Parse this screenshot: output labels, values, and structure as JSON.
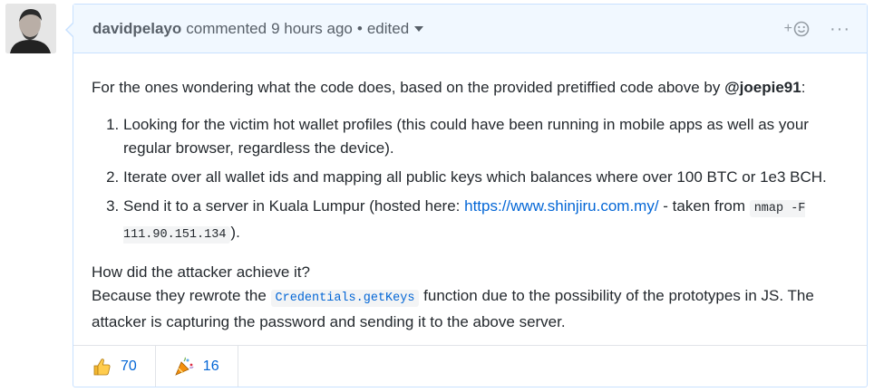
{
  "comment": {
    "author": "davidpelayo",
    "action": "commented",
    "time": "9 hours ago",
    "separator": "•",
    "edited_label": "edited"
  },
  "header_actions": {
    "add_reaction": "+",
    "more": "···"
  },
  "body": {
    "intro_text": "For the ones wondering what the code does, based on the provided pretiffied code above by ",
    "mention": "@joepie91",
    "intro_end": ":",
    "list": [
      "Looking for the victim hot wallet profiles (this could have been running in mobile apps as well as your regular browser, regardless the device).",
      "Iterate over all wallet ids and mapping all public keys which balances where over 100 BTC or 1e3 BCH.",
      {
        "before_link": "Send it to a server in Kuala Lumpur (hosted here: ",
        "link": "https://www.shinjiru.com.my/",
        "after_link": " - taken from ",
        "code": "nmap -F 111.90.151.134",
        "end": ")."
      }
    ],
    "question": "How did the attacker achieve it?",
    "answer_before": "Because they rewrote the ",
    "answer_code": "Credentials.getKeys",
    "answer_after": " function due to the possibility of the prototypes in JS. The attacker is capturing the password and sending it to the above server."
  },
  "reactions": [
    {
      "icon": "thumbs-up-icon",
      "count": "70"
    },
    {
      "icon": "tada-icon",
      "count": "16"
    }
  ],
  "colors": {
    "header_bg": "#f1f8ff",
    "border": "#c8e1ff",
    "link": "#0366d6"
  }
}
